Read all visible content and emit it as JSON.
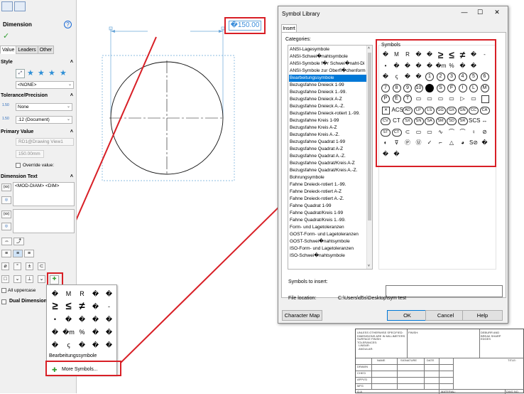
{
  "property_manager": {
    "title": "Dimension",
    "tabs": [
      "Value",
      "Leaders",
      "Other"
    ],
    "style": {
      "label": "Style",
      "combo_value": "<NONE>"
    },
    "tolerance": {
      "label": "Tolerance/Precision",
      "tolerance_value": "None",
      "precision_value": ".12 (Document)",
      "tol_icon_text": "1.50",
      "prec_icon_text": "1.50"
    },
    "primary_value": {
      "label": "Primary Value",
      "name_field": "RD1@Drawing View1",
      "value_field": "150.00mm",
      "override_label": "Override value:"
    },
    "dimension_text": {
      "label": "Dimension Text",
      "text_value": "<MOD-DIAM> <DIM>",
      "btn1": "(xx)",
      "btn2": "(xx)"
    },
    "symbol_tools_row1": [
      "⌀",
      "°",
      "±",
      "⊂"
    ],
    "symbol_tools_row2": [
      "□",
      "⌄",
      "⊥"
    ],
    "all_uppercase_label": "All uppercase",
    "dual_dimension_label": "Dual Dimension"
  },
  "drawing": {
    "dimension_text": "�150.00"
  },
  "popup": {
    "cells": [
      "�",
      "M",
      "R",
      "�",
      "�",
      "≥",
      "≤",
      "≠",
      "�",
      "-",
      "•",
      "�",
      "�",
      "�",
      "�",
      "�",
      "�m",
      "%",
      "�",
      "�",
      "�",
      "ꞔ",
      "�",
      "�",
      "�"
    ],
    "category": "Bearbeitungssymbole",
    "more_symbols": "More Symbols..."
  },
  "dialog": {
    "title": "Symbol Library",
    "tab": "Insert",
    "categories_label": "Categories:",
    "categories": [
      "ANSI-Lagesymbole",
      "ANSI-Schwei�nahtsymbole",
      "ANSI-Symbole f�r Schwei�naht-Di",
      "ANSI-Symbole zur Oberfl�chenform",
      "Bearbeitungssymbole",
      "Bezugsfahne Dreieck 1-99",
      "Bezugsfahne Dreieck 1.-99.",
      "Bezugsfahne Dreieck A-Z",
      "Bezugsfahne Dreieck A.-Z.",
      "Bezugsfahne Dreieck-rotiert 1.-99.",
      "Bezugsfahne Kreis 1-99",
      "Bezugsfahne Kreis A-Z",
      "Bezugsfahne Kreis A.-Z.",
      "Bezugsfahne Quadrat 1-99",
      "Bezugsfahne Quadrat A-Z",
      "Bezugsfahne Quadrat A.-Z.",
      "Bezugsfahne Quadrat/Kreis A-Z",
      "Bezugsfahne Quadrat/Kreis A.-Z.",
      "Bohrungsymbole",
      "Fahne Dreieck-rotiert 1.-99.",
      "Fahne Dreieck-rotiert A-Z",
      "Fahne Dreieck-rotiert A.-Z.",
      "Fahne Quadrat 1-99",
      "Fahne Quadrat/Kreis 1-99",
      "Fahne Quadrat/Kreis 1.-99.",
      "Form- und Lagetoleranzen",
      "GOST-Form- und Lagetoleranzen",
      "GOST-Schwei�nahtsymbole",
      "ISO-Form- und Lagetoleranzen",
      "ISO-Schwei�nahtsymbole"
    ],
    "selected_category_index": 4,
    "symbols_label": "Symbols",
    "symbols_to_insert_label": "Symbols to insert:",
    "file_location_label": "File location:",
    "file_location_value": "C:\\Users\\d5s\\Desktop\\sym test",
    "buttons": {
      "character_map": "Character Map",
      "ok": "OK",
      "cancel": "Cancel",
      "help": "Help"
    },
    "controls": {
      "minimize": "—",
      "maximize": "☐",
      "close": "✕"
    }
  },
  "title_block": {
    "notes": "UNLESS OTHERWISE SPECIFIED:\nDIMENSIONS ARE IN MILLIMETERS\nSURFACE FINISH:\nTOLERANCES:\n  LINEAR:\n  ANGULAR:",
    "finish": "FINISH:",
    "deburr": "DEBURR AND\nBREAK SHARP\nEDGES",
    "col_name": "NAME",
    "col_signature": "SIGNATURE",
    "col_date": "DATE",
    "title": "TITLE:",
    "rows": [
      "DRAWN",
      "CHK'D",
      "APPV'D",
      "MFG",
      "Q.A"
    ],
    "material": "MATERIAL:",
    "dwg_no": "DWG NO."
  },
  "colors": {
    "highlight_red": "#d81f26",
    "selection_blue": "#0078d7",
    "dimension_blue": "#3c8edb"
  }
}
